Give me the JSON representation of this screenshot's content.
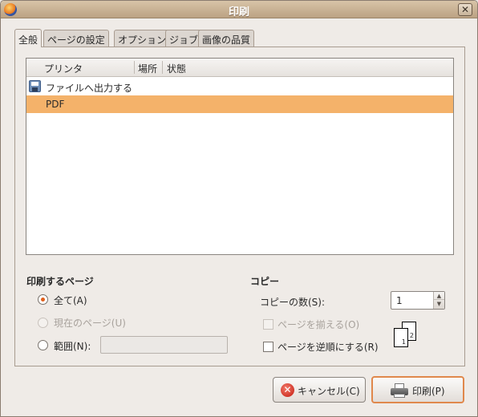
{
  "window": {
    "title": "印刷",
    "close_label": "✕"
  },
  "tabs": [
    {
      "label": "全般",
      "active": true
    },
    {
      "label": "ページの設定",
      "active": false
    },
    {
      "label": "オプション",
      "active": false
    },
    {
      "label": "ジョブ",
      "active": false
    },
    {
      "label": "画像の品質",
      "active": false
    }
  ],
  "printer_list": {
    "columns": [
      "プリンタ",
      "場所",
      "状態"
    ],
    "rows": [
      {
        "name": "ファイルへ出力する",
        "icon": "save-icon",
        "selected": false
      },
      {
        "name": "PDF",
        "icon": "",
        "selected": true
      }
    ]
  },
  "pages_section": {
    "title": "印刷するページ",
    "all_label": "全て(A)",
    "current_label": "現在のページ(U)",
    "range_label": "範囲(N):",
    "range_value": "",
    "selected_option": "all"
  },
  "copies_section": {
    "title": "コピー",
    "count_label": "コピーの数(S):",
    "count_value": "1",
    "collate_label": "ページを揃える(O)",
    "collate_checked": false,
    "collate_enabled": false,
    "reverse_label": "ページを逆順にする(R)",
    "reverse_checked": false,
    "preview_pages": [
      "1",
      "2"
    ]
  },
  "buttons": {
    "cancel_label": "キャンセル(C)",
    "print_label": "印刷(P)"
  },
  "colors": {
    "selection": "#f4b26a",
    "accent": "#e0601c",
    "default_button_border": "#e0884c"
  }
}
